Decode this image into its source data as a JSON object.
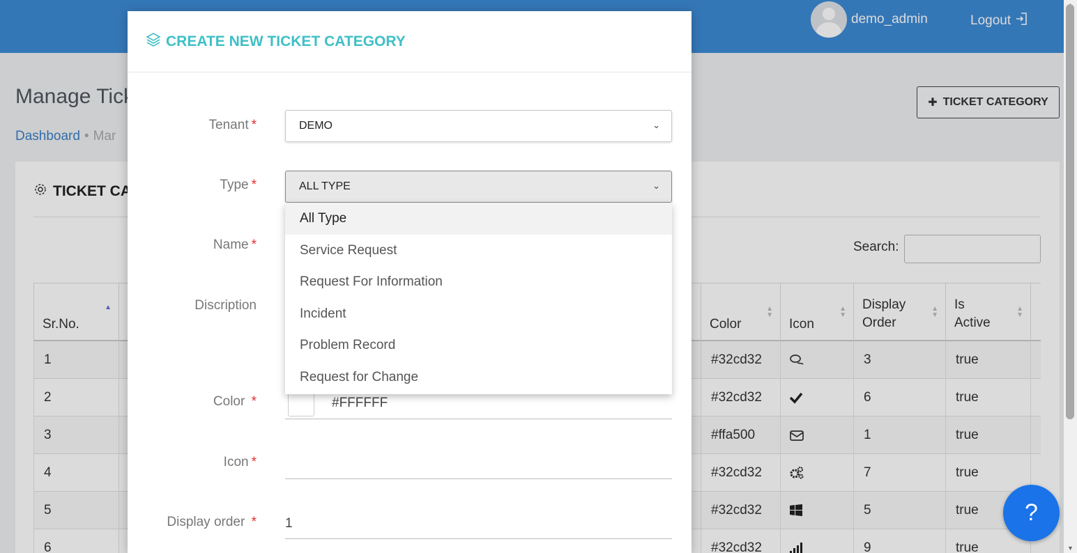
{
  "header": {
    "username": "demo_admin",
    "logout_label": "Logout"
  },
  "page": {
    "title": "Manage Tick",
    "breadcrumb": [
      "Dashboard",
      "Mar"
    ],
    "add_button_label": "TICKET CATEGORY",
    "card_title": "TICKET CA",
    "search_label": "Search:"
  },
  "table": {
    "headers": {
      "sr": "Sr.No.",
      "color": "Color",
      "icon": "Icon",
      "display_order": "Display Order",
      "is_active": "Is Active"
    },
    "rows": [
      {
        "sr": "1",
        "color": "#32cd32",
        "icon": "comments-icon",
        "order": "3",
        "active": "true"
      },
      {
        "sr": "2",
        "color": "#32cd32",
        "icon": "check-icon",
        "order": "6",
        "active": "true"
      },
      {
        "sr": "3",
        "color": "#ffa500",
        "icon": "envelope-icon",
        "order": "1",
        "active": "true"
      },
      {
        "sr": "4",
        "color": "#32cd32",
        "icon": "cogs-icon",
        "order": "7",
        "active": "true"
      },
      {
        "sr": "5",
        "color": "#32cd32",
        "icon": "windows-icon",
        "order": "5",
        "active": "true"
      },
      {
        "sr": "6",
        "color": "#32cd32",
        "icon": "signal-icon",
        "order": "9",
        "active": "true"
      }
    ]
  },
  "modal": {
    "title": "CREATE NEW TICKET CATEGORY",
    "fields": {
      "tenant_label": "Tenant",
      "tenant_value": "DEMO",
      "type_label": "Type",
      "type_value": "ALL TYPE",
      "name_label": "Name",
      "description_label": "Discription",
      "color_label": "Color",
      "color_value": "#FFFFFF",
      "icon_label": "Icon",
      "display_order_label": "Display order",
      "display_order_value": "1"
    },
    "type_options": [
      "All Type",
      "Service Request",
      "Request For Information",
      "Incident",
      "Problem Record",
      "Request for Change"
    ]
  },
  "help_label": "?",
  "colors": {
    "header_bg": "#3d8bd6",
    "modal_title": "#3fbfc6",
    "required": "#e03030",
    "help_button": "#1a73e8"
  }
}
